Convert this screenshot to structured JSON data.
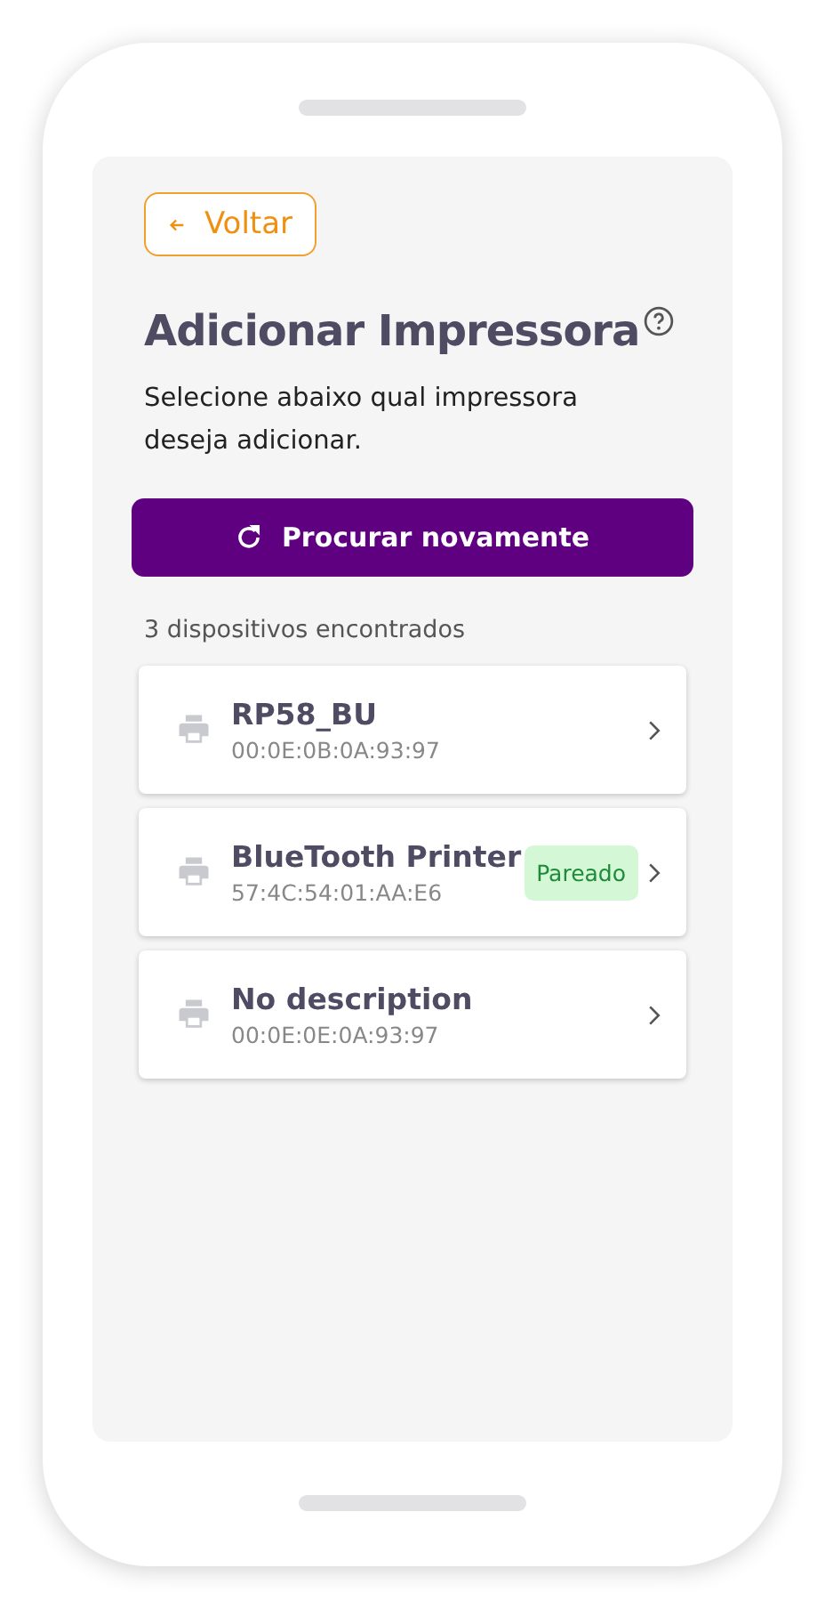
{
  "back_button": {
    "label": "Voltar"
  },
  "title": "Adicionar Impressora",
  "description": "Selecione abaixo qual impressora deseja adicionar.",
  "rescan_button": {
    "label": "Procurar novamente"
  },
  "found_count": "3 dispositivos encontrados",
  "devices": [
    {
      "name": "RP58_BU",
      "address": "00:0E:0B:0A:93:97",
      "paired": false
    },
    {
      "name": "BlueTooth Printer",
      "address": "57:4C:54:01:AA:E6",
      "paired": true,
      "badge": "Pareado"
    },
    {
      "name": "No description",
      "address": "00:0E:0E:0A:93:97",
      "paired": false
    }
  ]
}
